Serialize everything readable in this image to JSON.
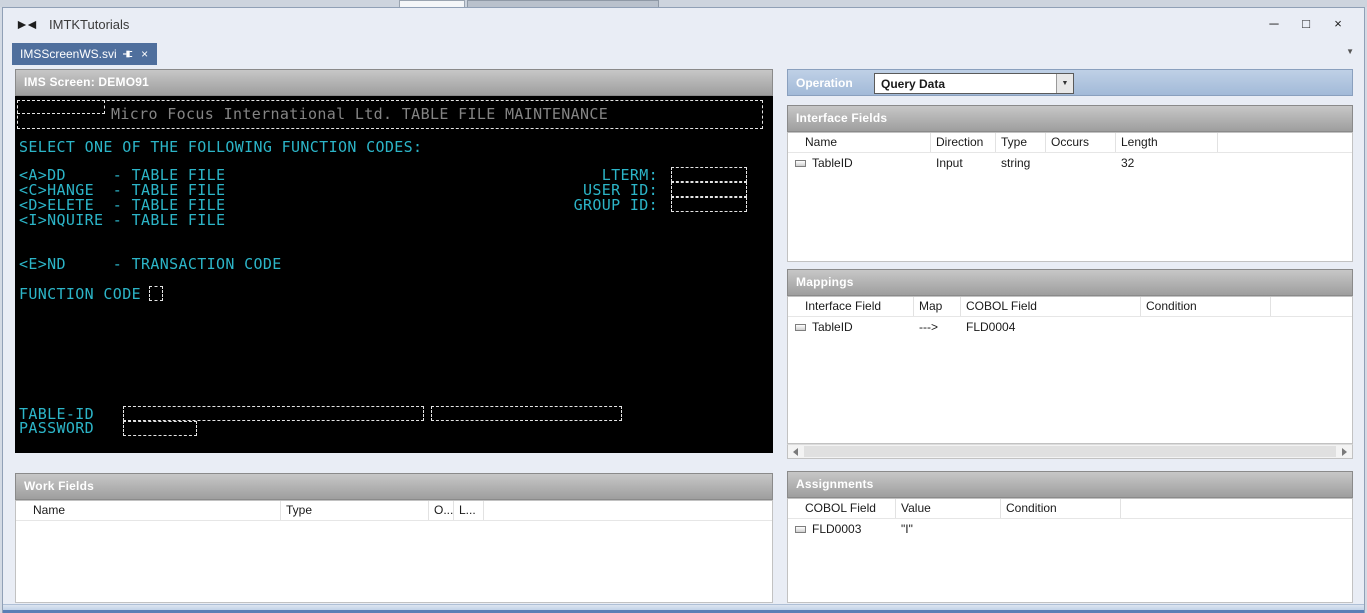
{
  "colors": {
    "active_tab": "#4f6f9d",
    "terminal_background": "#000000",
    "terminal_text": "#2cb5c8",
    "panel_caption_text": "#ffffff"
  },
  "window": {
    "title": "IMTKTutorials",
    "controls": {
      "minimize": "─",
      "maximize": "□",
      "close": "×"
    }
  },
  "tabbar": {
    "active_tab": "IMSScreenWS.svi",
    "close_glyph": "×",
    "caret_glyph": "▼"
  },
  "screen": {
    "caption": "IMS Screen: DEMO91",
    "banner": "Micro Focus International Ltd. TABLE FILE MAINTENANCE",
    "select_line": "SELECT ONE OF THE FOLLOWING FUNCTION CODES:",
    "function_codes": [
      "<A>DD     - TABLE FILE",
      "<C>HANGE  - TABLE FILE",
      "<D>ELETE  - TABLE FILE",
      "<I>NQUIRE - TABLE FILE"
    ],
    "right_labels": [
      "LTERM:",
      "USER ID:",
      "GROUP ID:"
    ],
    "end_line": "<E>ND     - TRANSACTION CODE",
    "function_code_label": "FUNCTION CODE",
    "table_id_label": "TABLE-ID",
    "password_label": "PASSWORD"
  },
  "operation": {
    "label": "Operation",
    "value": "Query Data",
    "caret_glyph": "▼"
  },
  "interface_fields": {
    "caption": "Interface Fields",
    "columns": [
      "Name",
      "Direction",
      "Type",
      "Occurs",
      "Length"
    ],
    "rows": [
      {
        "name": "TableID",
        "direction": "Input",
        "type": "string",
        "occurs": "",
        "length": "32"
      }
    ]
  },
  "mappings": {
    "caption": "Mappings",
    "columns": [
      "Interface Field",
      "Map",
      "COBOL Field",
      "Condition"
    ],
    "rows": [
      {
        "interface_field": "TableID",
        "map": "--->",
        "cobol_field": "FLD0004",
        "condition": ""
      }
    ]
  },
  "work_fields": {
    "caption": "Work Fields",
    "columns": [
      "Name",
      "Type",
      "O...",
      "L..."
    ]
  },
  "assignments": {
    "caption": "Assignments",
    "columns": [
      "COBOL Field",
      "Value",
      "Condition"
    ],
    "rows": [
      {
        "cobol_field": "FLD0003",
        "value": "\"I\"",
        "condition": ""
      }
    ]
  }
}
